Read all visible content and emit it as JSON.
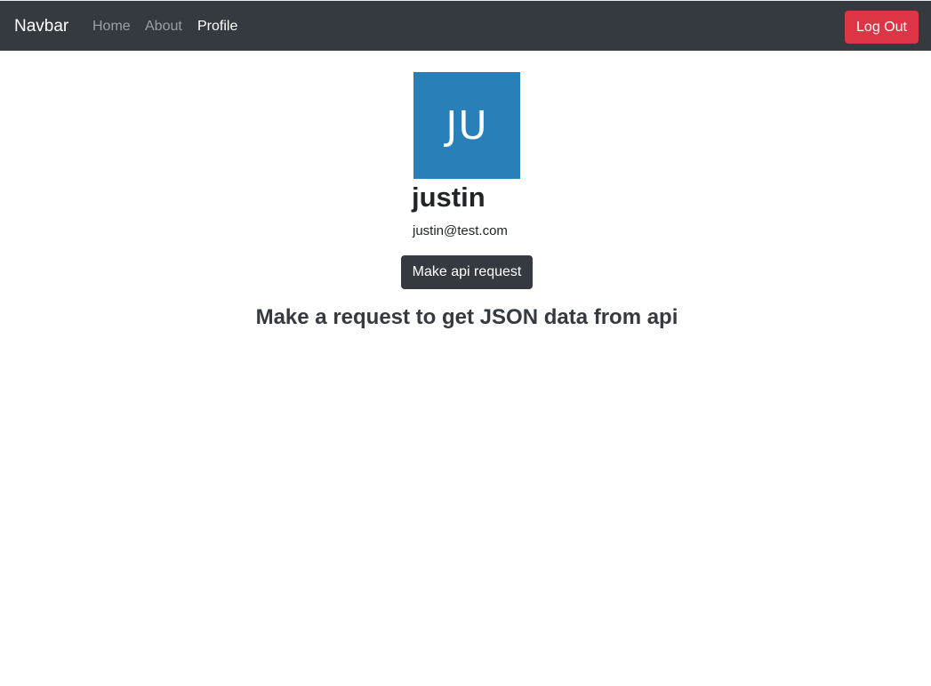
{
  "navbar": {
    "brand": "Navbar",
    "links": [
      {
        "label": "Home",
        "active": false
      },
      {
        "label": "About",
        "active": false
      },
      {
        "label": "Profile",
        "active": true
      }
    ],
    "logout_label": "Log Out"
  },
  "profile": {
    "avatar_initials": "JU",
    "avatar_color": "#2980b9",
    "name": "justin",
    "email": "justin@test.com",
    "api_button_label": "Make api request",
    "result_text": "Make a request to get JSON data from api"
  },
  "colors": {
    "navbar_bg": "#343a40",
    "logout_bg": "#dc3545",
    "api_button_bg": "#343a40"
  }
}
